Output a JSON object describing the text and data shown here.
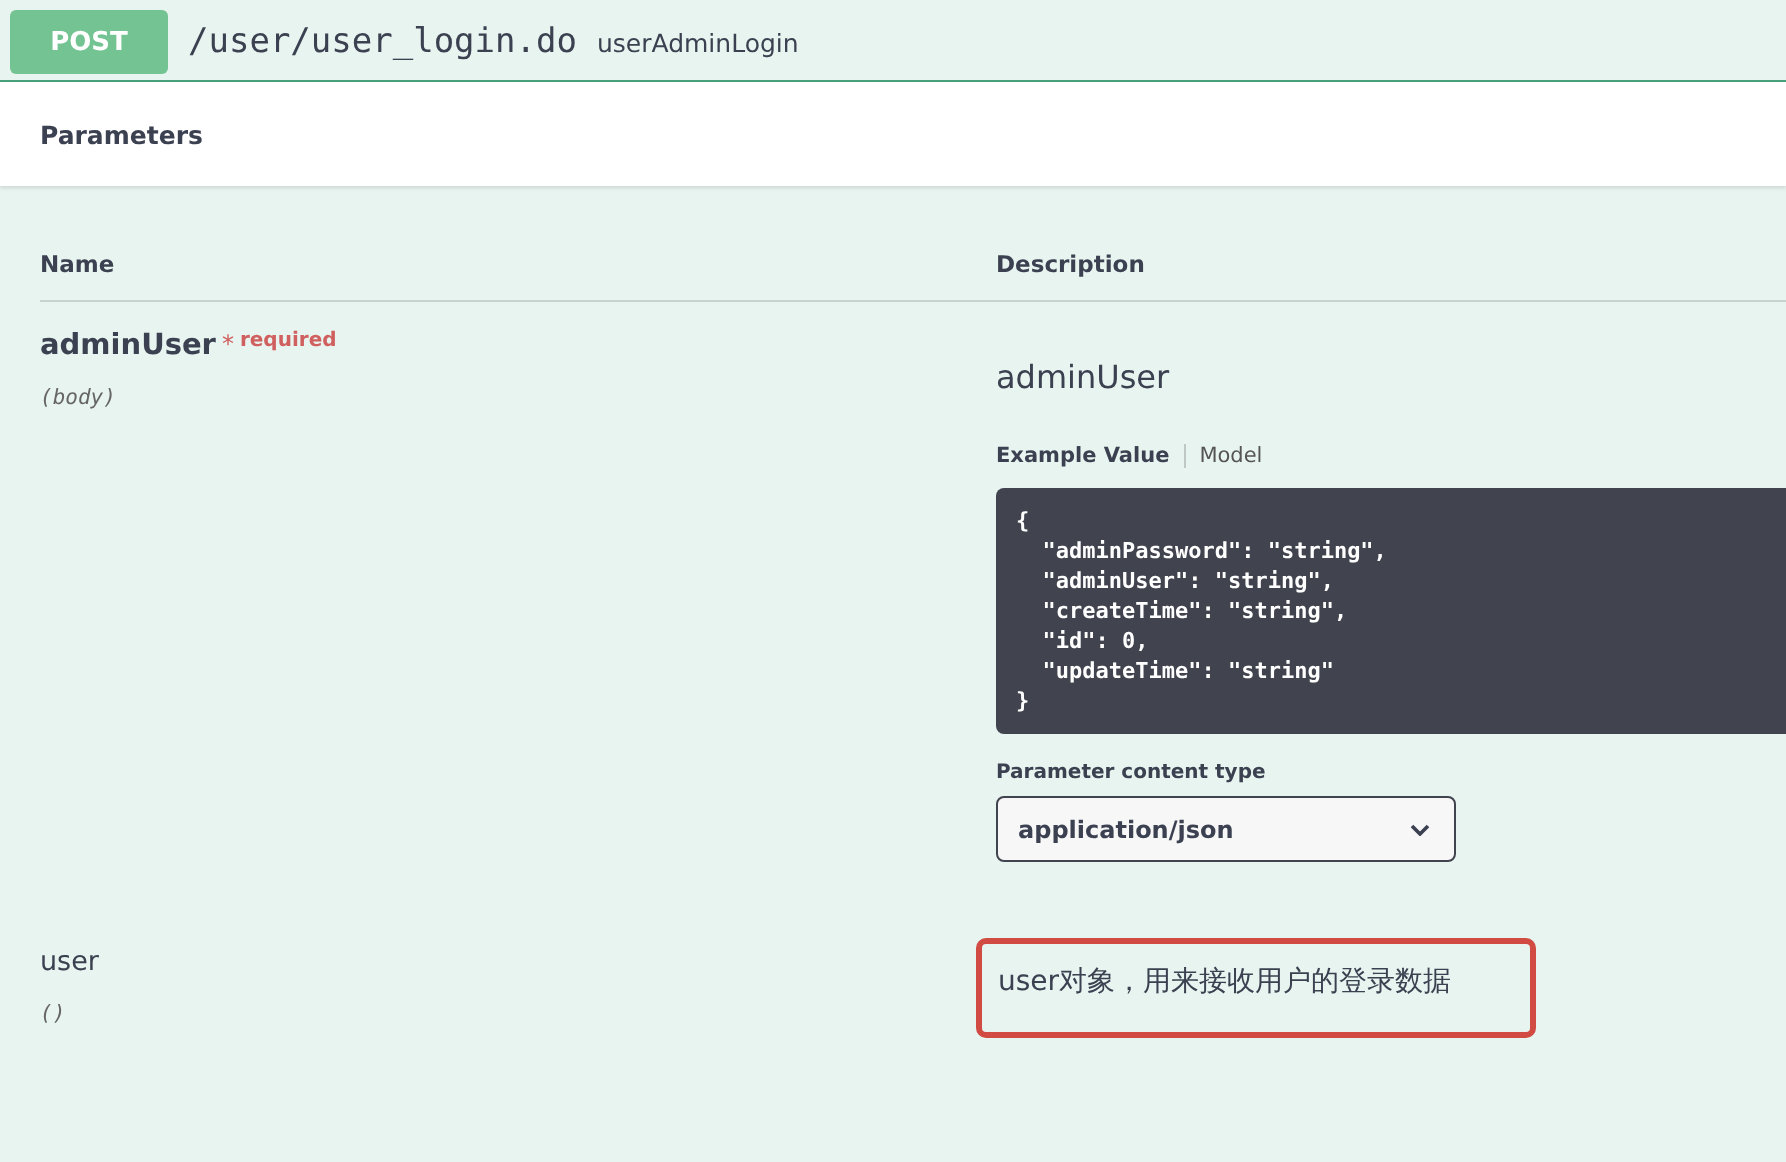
{
  "operation": {
    "method": "POST",
    "path": "/user/user_login.do",
    "summary": "userAdminLogin"
  },
  "section_title": "Parameters",
  "columns": [
    "Name",
    "Description"
  ],
  "parameters": [
    {
      "name": "adminUser",
      "required": true,
      "required_marker": "*",
      "required_label": "required",
      "in": "(body)",
      "description": "adminUser",
      "highlighted": false,
      "example_tabs": [
        {
          "label": "Example Value",
          "selected": true
        },
        {
          "label": "Model",
          "selected": false
        }
      ],
      "example": "{\n  \"adminPassword\": \"string\",\n  \"adminUser\": \"string\",\n  \"createTime\": \"string\",\n  \"id\": 0,\n  \"updateTime\": \"string\"\n}",
      "content_type_label": "Parameter content type",
      "content_type": "application/json"
    },
    {
      "name": "user",
      "required": false,
      "in": "()",
      "description": "user对象，用来接收用户的登录数据",
      "highlighted": true
    }
  ]
}
